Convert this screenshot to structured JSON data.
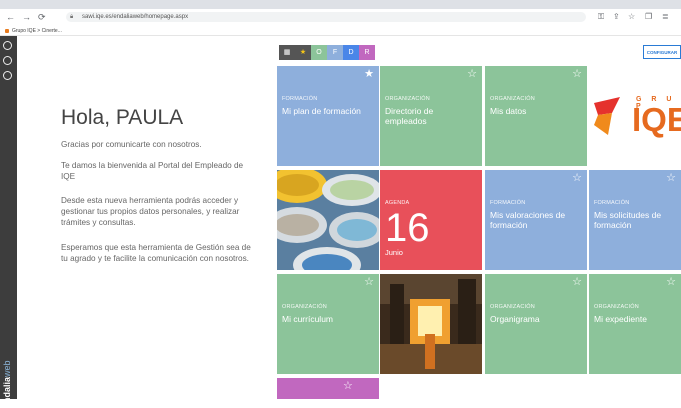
{
  "browser": {
    "url": "sawi.iqe.es/endaliaweb/homepage.aspx",
    "bookmark": "Grupo IQE > Cinerte..."
  },
  "sidebar": {
    "brand_bold": "endalia",
    "brand_light": "web"
  },
  "greeting": {
    "title": "Hola, PAULA",
    "p1": "Gracias por comunicarte con nosotros.",
    "p2": "Te damos la bienvenida al Portal del Empleado de IQE",
    "p3": "Desde esta nueva herramienta podrás acceder y gestionar tus propios datos personales, y realizar trámites y consultas.",
    "p4": "Esperamos que esta herramienta de Gestión sea de tu agrado y te facilite la comunicación con nosotros."
  },
  "filters": {
    "grid": "▦",
    "star": "★",
    "o": "O",
    "f": "F",
    "d": "D",
    "r": "R"
  },
  "config_label": "CONFIGURAR",
  "logo": {
    "grupo": "G R U P",
    "iqe": "IQE"
  },
  "tiles": {
    "t1": {
      "cat": "FORMACIÓN",
      "title": "Mi plan de formación"
    },
    "t2": {
      "cat": "ORGANIZACIÓN",
      "title": "Directorio de empleados"
    },
    "t3": {
      "cat": "ORGANIZACIÓN",
      "title": "Mis datos"
    },
    "agenda": {
      "cat": "AGENDA",
      "day": "16",
      "month": "Junio"
    },
    "t5": {
      "cat": "FORMACIÓN",
      "title": "Mis valoraciones de formación"
    },
    "t6": {
      "cat": "FORMACIÓN",
      "title": "Mis solicitudes de formación"
    },
    "t7": {
      "cat": "ORGANIZACIÓN",
      "title": "Mi currículum"
    },
    "t8": {
      "cat": "ORGANIZACIÓN",
      "title": "Organigrama"
    },
    "t9": {
      "cat": "ORGANIZACIÓN",
      "title": "Mi expediente"
    }
  },
  "colors": {
    "green": "#8cc49a",
    "blue": "#8eafdc",
    "red": "#e8505a",
    "purple": "#c168bf",
    "filter_grid": "#555555",
    "filter_star": "#555555",
    "filter_o": "#8cc49a",
    "filter_f": "#8eafdc",
    "filter_d": "#4a86e8",
    "filter_r": "#c168bf"
  }
}
